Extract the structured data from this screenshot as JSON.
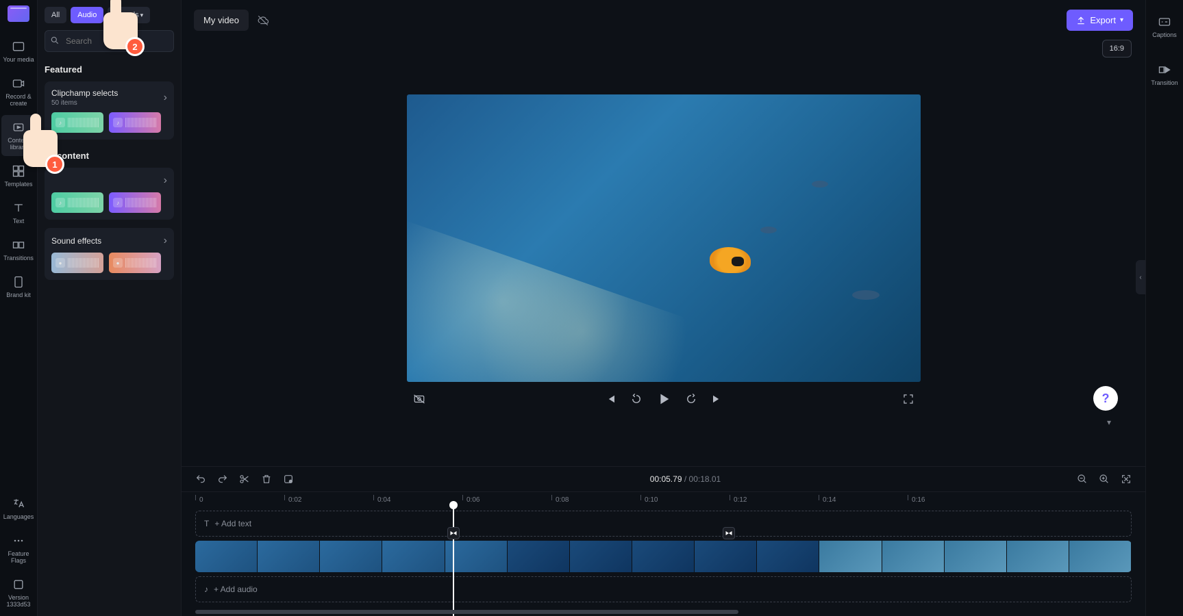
{
  "app_title": "My video",
  "aspect_ratio": "16:9",
  "export_label": "Export",
  "left_nav": [
    {
      "label": "Your media"
    },
    {
      "label": "Record & create"
    },
    {
      "label": "Content library"
    },
    {
      "label": "Templates"
    },
    {
      "label": "Text"
    },
    {
      "label": "Transitions"
    },
    {
      "label": "Brand kit"
    }
  ],
  "left_nav_bottom": [
    {
      "label": "Languages"
    },
    {
      "label": "Feature Flags"
    },
    {
      "label": "Version 1333d53"
    }
  ],
  "right_nav": [
    {
      "label": "Captions"
    },
    {
      "label": "Transition"
    }
  ],
  "panel": {
    "tabs": {
      "all": "All",
      "audio": "Audio",
      "visuals": "Visuals"
    },
    "search_placeholder": "Search",
    "featured_title": "Featured",
    "featured_card": {
      "title": "Clipchamp selects",
      "sub": "50 items"
    },
    "content_heading": "content",
    "sound_effects_title": "Sound effects"
  },
  "playback": {
    "current": "00:05.79",
    "total": "00:18.01"
  },
  "ruler": [
    "0",
    "0:02",
    "0:04",
    "0:06",
    "0:08",
    "0:10",
    "0:12",
    "0:14",
    "0:16"
  ],
  "track_labels": {
    "add_text": "+ Add text",
    "add_audio": "+ Add audio"
  },
  "callouts": {
    "one": "1",
    "two": "2"
  },
  "help": "?"
}
